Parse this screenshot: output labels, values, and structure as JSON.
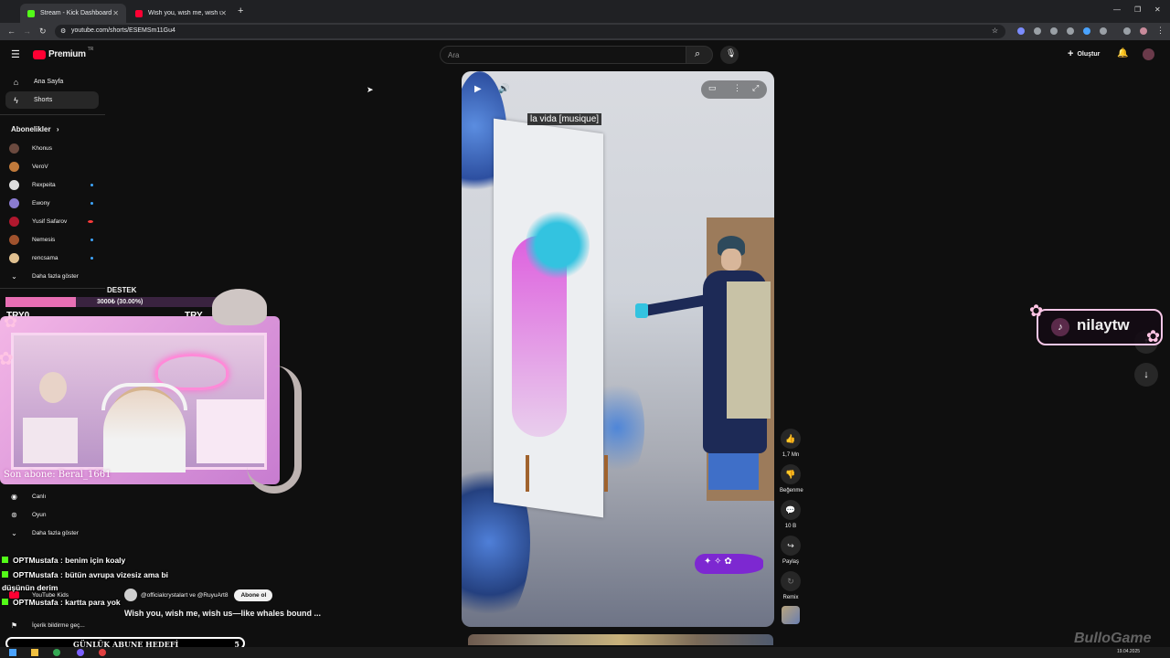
{
  "browser": {
    "tabs": [
      {
        "title": "Stream - Kick Dashboard",
        "color": "#53fc18"
      },
      {
        "title": "Wish you, wish me, wish us—lik",
        "color": "#ff0033"
      }
    ],
    "url": "youtube.com/shorts/ESEMSm11Gu4"
  },
  "header": {
    "logo": "Premium",
    "country": "TR",
    "search_placeholder": "Ara",
    "create_label": "Oluştur"
  },
  "sidebar": {
    "main": [
      {
        "label": "Ana Sayfa",
        "icon": "home-icon"
      },
      {
        "label": "Shorts",
        "icon": "shorts-icon"
      }
    ],
    "subscriptions_title": "Abonelikler",
    "subscriptions": [
      {
        "name": "Khonus",
        "color": "#6b4a3f",
        "live": false
      },
      {
        "name": "VeroV",
        "color": "#c07a3b",
        "live": false
      },
      {
        "name": "Rexpeita",
        "color": "#dddddd",
        "live": true
      },
      {
        "name": "Ewony",
        "color": "#8a7bd1",
        "live": true
      },
      {
        "name": "Yusif Safarov",
        "color": "#b0182e",
        "live": true
      },
      {
        "name": "Nemesis",
        "color": "#a0522d",
        "live": true
      },
      {
        "name": "rencsama",
        "color": "#e0c090",
        "live": true
      }
    ],
    "show_more": "Daha fazla göster",
    "explore": [
      {
        "label": "Canlı",
        "icon": "live-icon"
      },
      {
        "label": "Oyun",
        "icon": "gaming-icon"
      }
    ],
    "show_more2": "Daha fazla göster",
    "kids": "YouTube Kids",
    "report": "İçerik bildirme geç..."
  },
  "video": {
    "caption": "la vida [musique]",
    "channel": "@officialcrystalart ve @RuyuArt8",
    "subscribe": "Abone ol",
    "title": "Wish you, wish me, wish us—like whales bound ...",
    "likes": "1,7 Mn",
    "dislike": "Beğenme",
    "comments": "10 B",
    "share": "Paylaş",
    "remix": "Remix"
  },
  "overlay": {
    "goal_title": "DESTEK",
    "goal_text": "3000₺ (30.00%)",
    "goal_fraction": 0.3,
    "side_text_left": "TRY0",
    "side_text_right": "TRY",
    "last_sub": "Son abone: Beral_1661",
    "tiktok_handle": "nilaytw",
    "bottom_goal": "GÜNLÜK ABUNE HEDEFİ",
    "bottom_count": "5",
    "watermark": "BulloGame",
    "date": "19.04.2025"
  },
  "chat": [
    "OPTMustafa : benim için koaly",
    "OPTMustafa : bütün avrupa vizesiz ama bi",
    "düşünün derim",
    "OPTMustafa : kartta para yok"
  ]
}
